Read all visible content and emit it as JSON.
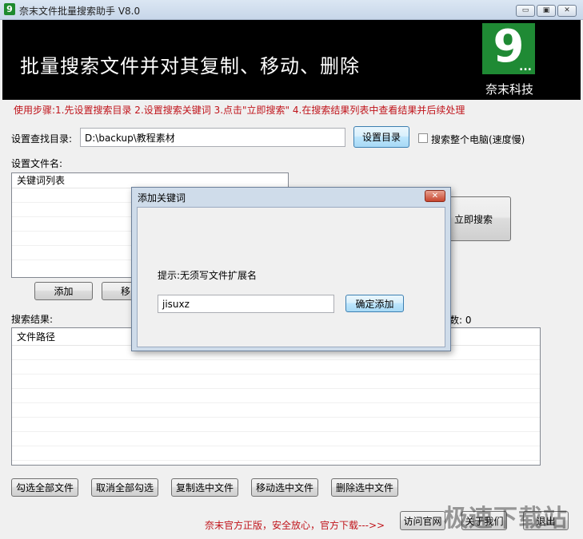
{
  "window": {
    "icon_glyph": "9",
    "title": "奈末文件批量搜索助手 V8.0",
    "minimize_glyph": "▭",
    "restore_glyph": "▣",
    "close_glyph": "✕"
  },
  "banner": {
    "heading": "批量搜索文件并对其复制、移动、删除",
    "logo_glyph": "9",
    "logo_dots": "...",
    "brand": "奈末科技"
  },
  "steps_text": "使用步骤:1.先设置搜索目录 2.设置搜索关键词 3.点击\"立即搜索\" 4.在搜索结果列表中查看结果并后续处理",
  "directory": {
    "label": "设置查找目录:",
    "value": "D:\\backup\\教程素材",
    "set_button": "设置目录",
    "whole_pc_label": "搜索整个电脑(速度慢)"
  },
  "filename": {
    "label": "设置文件名:",
    "list_header": "关键词列表",
    "add_button": "添加",
    "remove_button_partial": "移"
  },
  "search_button": "立即搜索",
  "results": {
    "label": "搜索结果:",
    "count_partial": "数: 0",
    "column_header": "文件路径"
  },
  "actions": {
    "select_all": "勾选全部文件",
    "deselect_all": "取消全部勾选",
    "copy_selected": "复制选中文件",
    "move_selected": "移动选中文件",
    "delete_selected": "删除选中文件"
  },
  "footer": {
    "note": "奈末官方正版，安全放心，官方下载--->>",
    "visit_site": "访问官网",
    "about_partial": "关于我们",
    "exit_partial": "退出"
  },
  "watermark": "极速下载站",
  "dialog": {
    "title": "添加关键词",
    "close_glyph": "✕",
    "hint": "提示:无须写文件扩展名",
    "input_value": "jisuxz",
    "confirm_button": "确定添加"
  }
}
